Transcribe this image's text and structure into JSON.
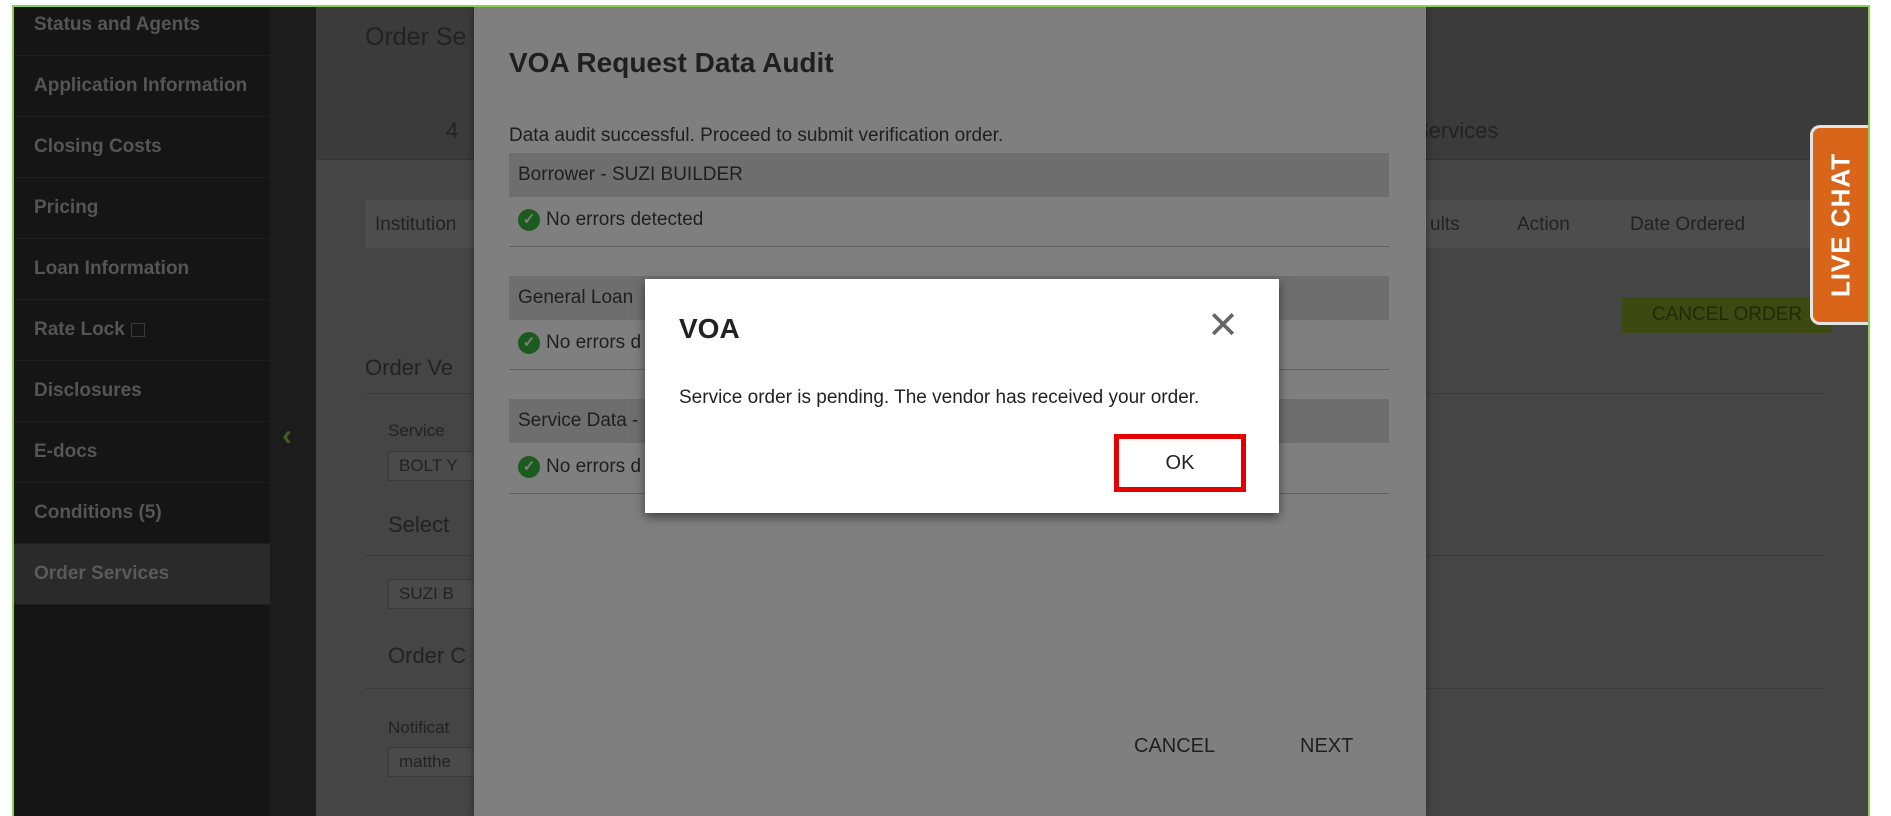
{
  "sidebar": {
    "items": [
      {
        "label": "Status and Agents"
      },
      {
        "label": "Application Information"
      },
      {
        "label": "Closing Costs"
      },
      {
        "label": "Pricing"
      },
      {
        "label": "Loan Information"
      },
      {
        "label": "Rate Lock"
      },
      {
        "label": "Disclosures"
      },
      {
        "label": "E-docs"
      },
      {
        "label": "Conditions (5)"
      },
      {
        "label": "Order Services"
      }
    ]
  },
  "main": {
    "title_fragment": "Order Se",
    "header_num_fragment": "4",
    "header_services_fragment": "Services",
    "table_headers": {
      "institution_fragment": "Institution",
      "results_fragment": "ults",
      "action": "Action",
      "date_ordered": "Date Ordered"
    },
    "cancel_order_label": "CANCEL ORDER",
    "order_ve_fragment": "Order Ve",
    "service_label_fragment": "Service",
    "service_value_fragment": "BOLT Y",
    "select_fragment": "Select",
    "borrower_value_fragment": "SUZI B",
    "order_c_fragment": "Order C",
    "notification_fragment": "Notificat",
    "email_fragment": "matthe"
  },
  "live_chat": {
    "label": "LIVE CHAT"
  },
  "audit_modal": {
    "title": "VOA Request Data Audit",
    "subtitle": "Data audit successful. Proceed to submit verification order.",
    "sections": [
      {
        "header": "Borrower - SUZI BUILDER",
        "status": "No errors detected"
      },
      {
        "header": "General Loan",
        "status": "No errors d"
      },
      {
        "header": "Service Data -",
        "status": "No errors d"
      }
    ],
    "cancel_label": "CANCEL",
    "next_label": "NEXT"
  },
  "voa_dialog": {
    "title": "VOA",
    "message": "Service order is pending. The vendor has received your order.",
    "ok_label": "OK",
    "close_glyph": "✕"
  },
  "colors": {
    "highlight": "#e30000",
    "live_chat": "#d9651b",
    "success": "#1d5a1d"
  }
}
